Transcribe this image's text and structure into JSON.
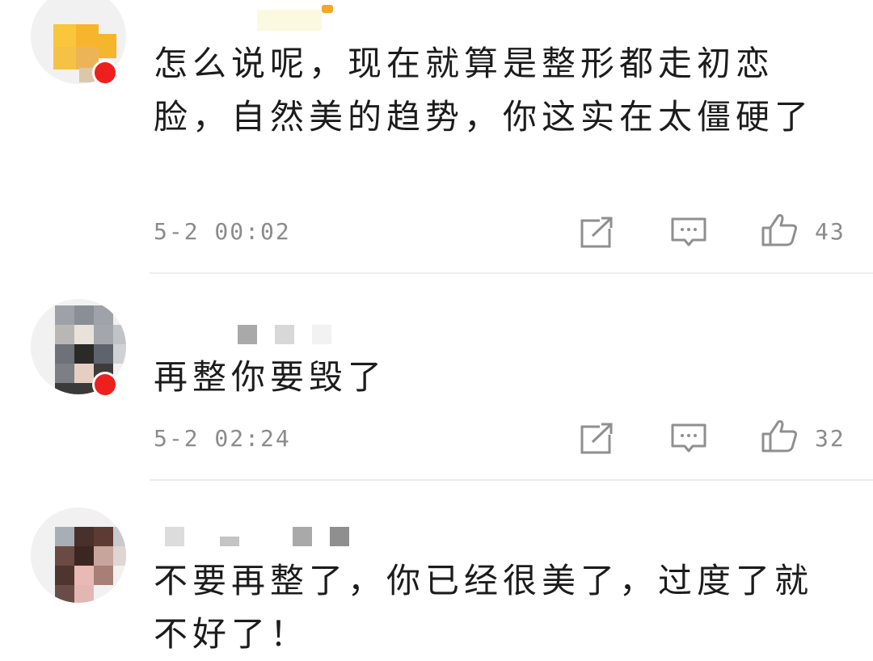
{
  "comments": [
    {
      "avatar_icon": "user-avatar-pixelated",
      "text": "怎么说呢，现在就算是整形都走初恋脸，自然美的趋势，你这实在太僵硬了",
      "time": "5-2 00:02",
      "likes": "43"
    },
    {
      "avatar_icon": "user-avatar-pixelated",
      "text": "再整你要毁了",
      "time": "5-2 02:24",
      "likes": "32"
    },
    {
      "avatar_icon": "user-avatar-pixelated",
      "text": "不要再整了，你已经很美了，过度了就不好了！"
    }
  ],
  "icons": {
    "share": "share-icon",
    "reply": "comment-icon",
    "like": "thumbs-up-icon",
    "verified": "verified-badge-icon"
  },
  "colors": {
    "text": "#1c1c1c",
    "meta": "#8b8b8b",
    "divider": "#ececec",
    "badge": "#ee1f1f"
  }
}
